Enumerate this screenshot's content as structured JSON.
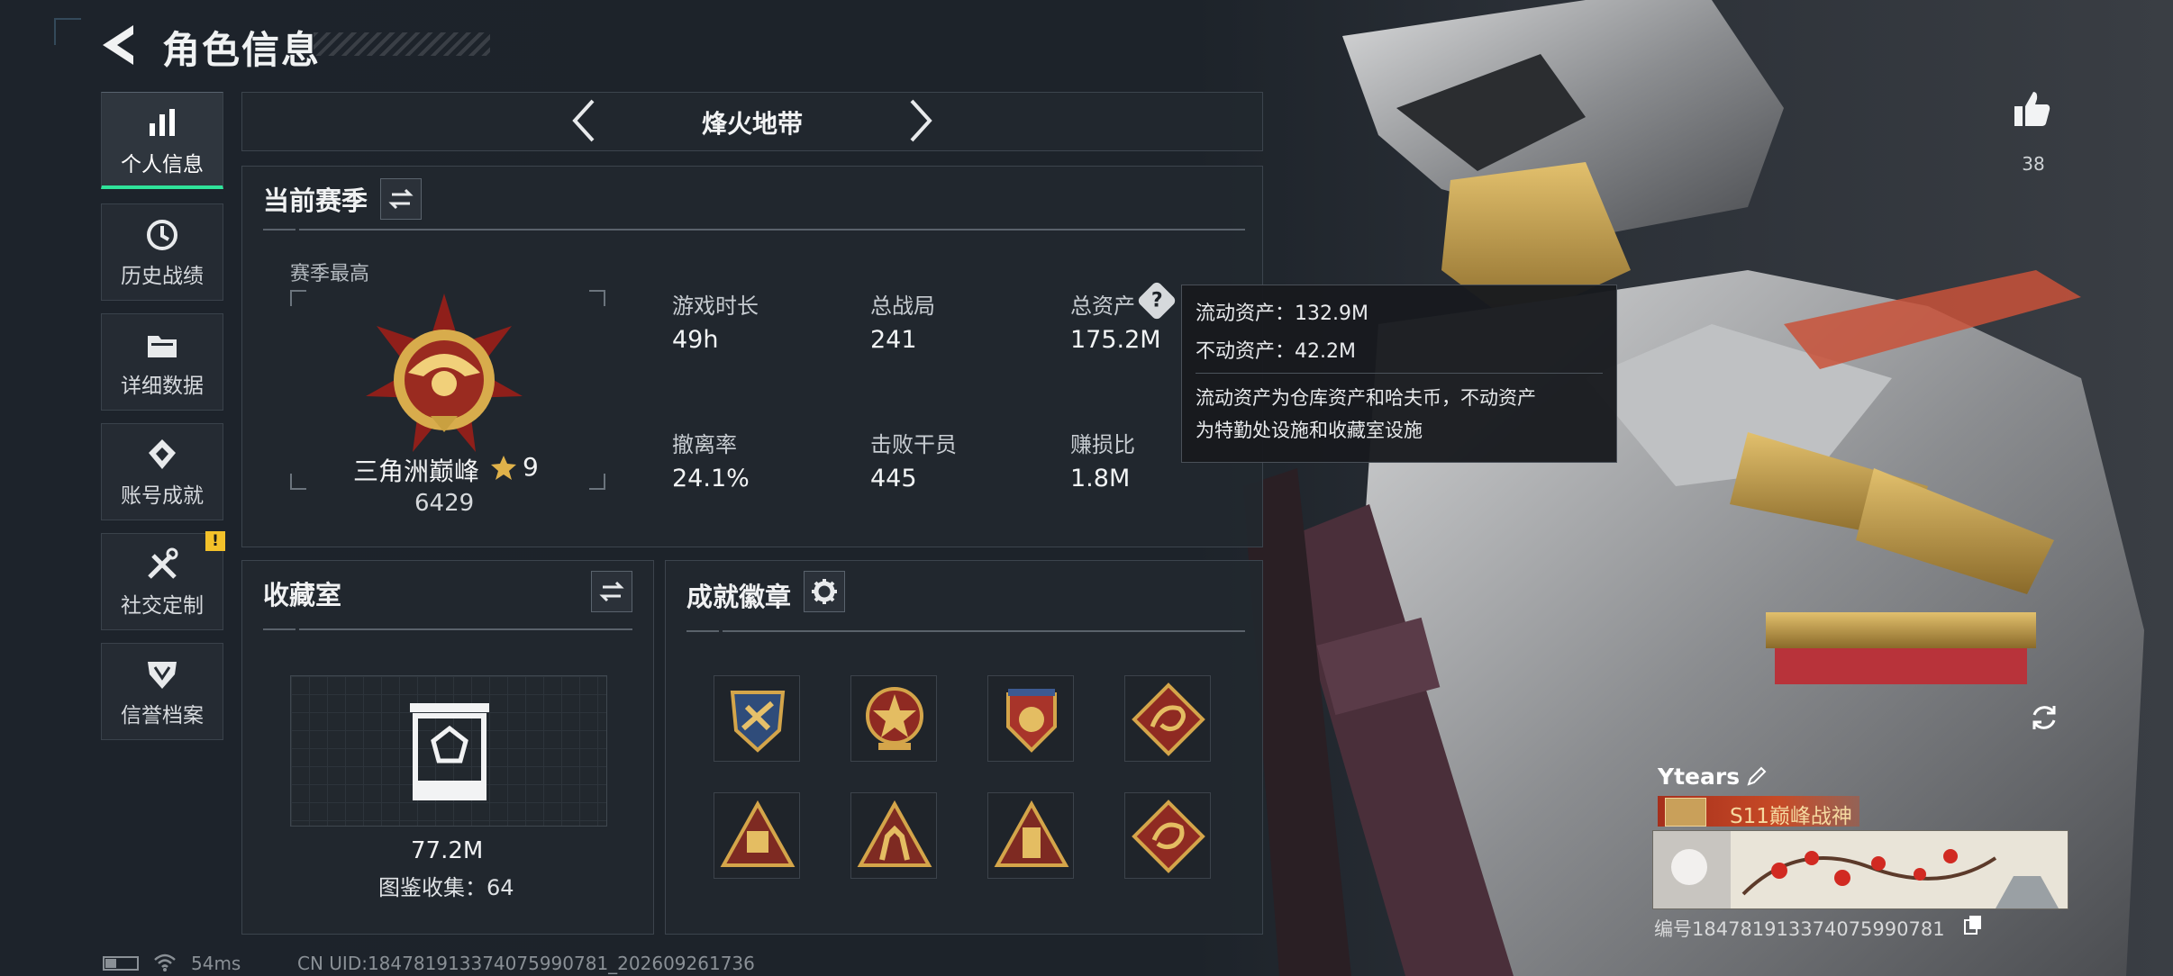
{
  "header": {
    "title": "角色信息"
  },
  "sidebar": {
    "items": [
      {
        "label": "个人信息",
        "icon": "bar-chart-icon",
        "active": true
      },
      {
        "label": "历史战绩",
        "icon": "clock-history-icon"
      },
      {
        "label": "详细数据",
        "icon": "folder-icon"
      },
      {
        "label": "账号成就",
        "icon": "achievement-icon"
      },
      {
        "label": "社交定制",
        "icon": "tools-icon",
        "alert": "!"
      },
      {
        "label": "信誉档案",
        "icon": "shield-icon"
      }
    ]
  },
  "mode": {
    "name": "烽火地带"
  },
  "season": {
    "title": "当前赛季",
    "best_label": "赛季最高",
    "rank_name": "三角洲巅峰",
    "rank_stars": "9",
    "rank_score": "6429",
    "stats": [
      {
        "label": "游戏时长",
        "value": "49h"
      },
      {
        "label": "总战局",
        "value": "241"
      },
      {
        "label": "总资产",
        "value": "175.2M"
      },
      {
        "label": "撤离率",
        "value": "24.1%"
      },
      {
        "label": "击败干员",
        "value": "445"
      },
      {
        "label": "赚损比",
        "value": "1.8M"
      }
    ],
    "help_icon": "?"
  },
  "tooltip": {
    "line1": "流动资产：132.9M",
    "line2": "不动资产：42.2M",
    "desc1": "流动资产为仓库资产和哈夫币，不动资产",
    "desc2": "为特勤处设施和收藏室设施"
  },
  "collection": {
    "title": "收藏室",
    "value": "77.2M",
    "catalog": "图鉴收集：64"
  },
  "badges": {
    "title": "成就徽章",
    "items": [
      "badge-1",
      "badge-2",
      "badge-3",
      "badge-4",
      "badge-5",
      "badge-6",
      "badge-7",
      "badge-8"
    ]
  },
  "player": {
    "name": "Ytears",
    "title_banner": "S11巅峰战神",
    "id_line": "编号1847819133740759907​81"
  },
  "likes": {
    "count": "38"
  },
  "status": {
    "ping": "54ms",
    "uid": "CN UID:1847819133740759907​81_202609261736"
  },
  "colors": {
    "accent": "#2fe39a",
    "gold": "#d9a93e",
    "alert": "#f3c12a"
  }
}
